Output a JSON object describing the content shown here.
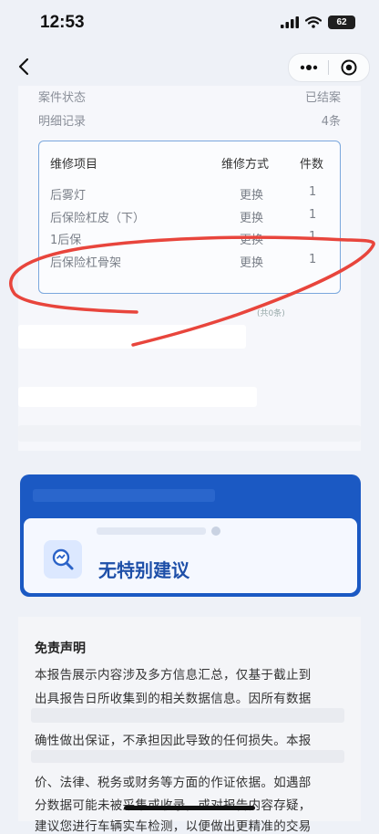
{
  "status": {
    "time": "12:53",
    "battery": "62"
  },
  "case": {
    "status_label": "案件状态",
    "status_value": "已结案",
    "records_label": "明细记录",
    "records_value": "4条"
  },
  "repair_table": {
    "headers": [
      "维修项目",
      "维修方式",
      "件数"
    ],
    "rows": [
      {
        "item": "后雾灯",
        "method": "更换",
        "count": "1"
      },
      {
        "item": "后保险杠皮（下）",
        "method": "更换",
        "count": "1"
      },
      {
        "item": "1后保",
        "method": "更换",
        "count": "1"
      },
      {
        "item": "后保险杠骨架",
        "method": "更换",
        "count": "1"
      }
    ]
  },
  "count_note": "(共0条)",
  "advice": {
    "text": "无特别建议"
  },
  "disclaimer": {
    "title": "免责声明",
    "lines": [
      "本报告展示内容涉及多方信息汇总，仅基于截止到",
      "出具报告日所收集到的相关数据信息。因所有数据",
      "确性做出保证，不承担因此导致的任何损失。本报",
      "价、法律、税务或财务等方面的作证依据。如遇部",
      "分数据可能未被采集或收录，或对报告内容存疑，",
      "建议您进行车辆实车检测，以便做出更精准的交易"
    ]
  },
  "colors": {
    "accent": "#1b59c3",
    "scribble": "#e8453c",
    "table_border": "#7aa7dd"
  },
  "icons": [
    "back-icon",
    "more-icon",
    "close-target-icon",
    "report-search-icon",
    "signal-icon",
    "wifi-icon",
    "battery-icon"
  ]
}
